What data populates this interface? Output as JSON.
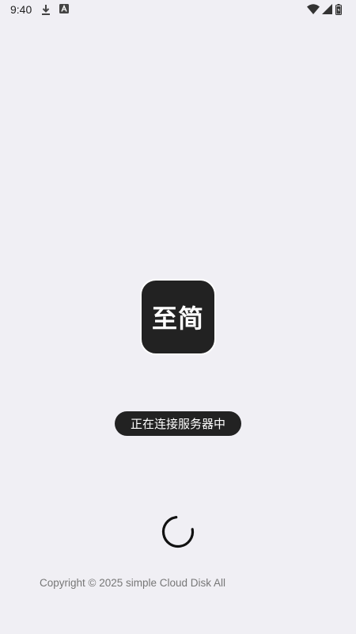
{
  "status_bar": {
    "time": "9:40",
    "left_icons": [
      "download-icon",
      "autofill-icon"
    ],
    "right_icons": [
      "wifi-icon",
      "cell-signal-icon",
      "battery-icon"
    ]
  },
  "app": {
    "logo_text": "至简",
    "logo_bg_color": "#222222",
    "connection_status": "正在连接服务器中",
    "copyright": "Copyright © 2025 simple Cloud Disk All"
  },
  "colors": {
    "background": "#f0eff4",
    "accent": "#222222"
  }
}
